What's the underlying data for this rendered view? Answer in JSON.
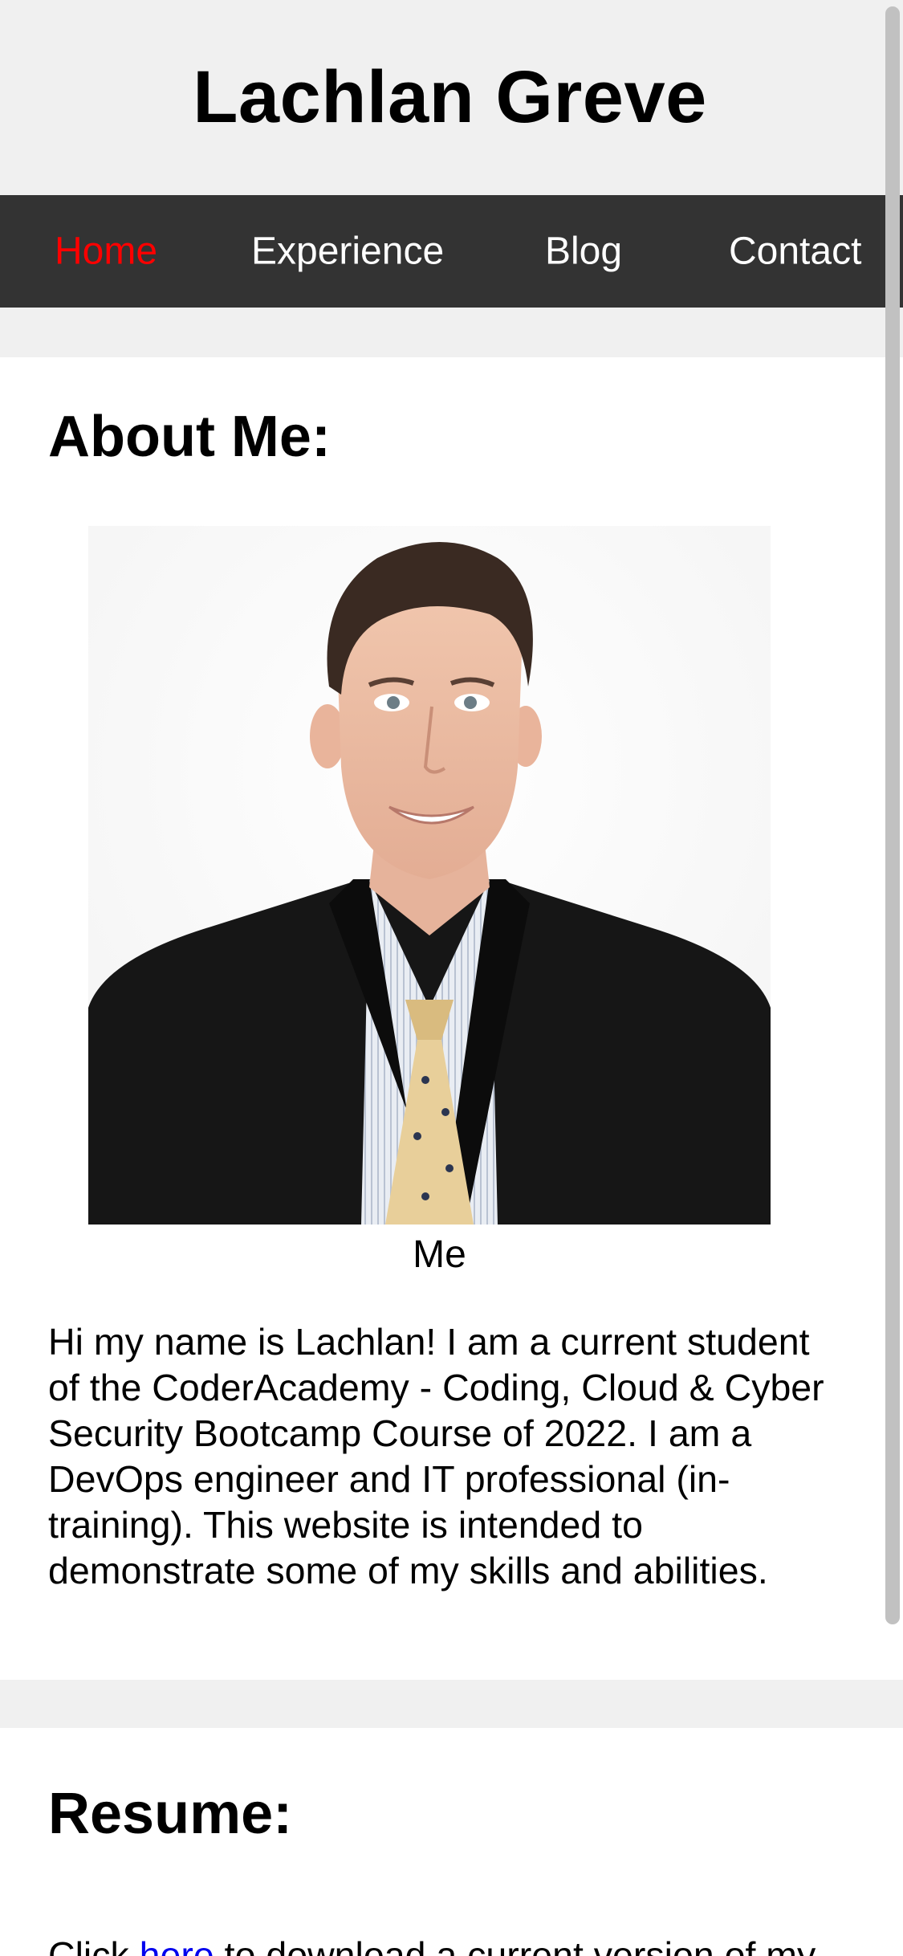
{
  "site": {
    "title": "Lachlan Greve"
  },
  "nav": {
    "items": [
      {
        "label": "Home",
        "active": true
      },
      {
        "label": "Experience",
        "active": false
      },
      {
        "label": "Blog",
        "active": false
      },
      {
        "label": "Contact",
        "active": false
      }
    ],
    "active_color": "#ff0000",
    "bar_color": "#333333"
  },
  "about": {
    "heading": "About Me:",
    "photo_caption": "Me",
    "bio": "Hi my name is Lachlan! I am a current student of the CoderAcademy - Coding, Cloud & Cyber Security Bootcamp Course of 2022. I am a DevOps engineer and IT professional (in-training). This website is intended to demonstrate some of my skills and abilities."
  },
  "resume": {
    "heading": "Resume:",
    "text_before": "Click ",
    "link_label": "here",
    "text_after": " to download a current version of my"
  }
}
